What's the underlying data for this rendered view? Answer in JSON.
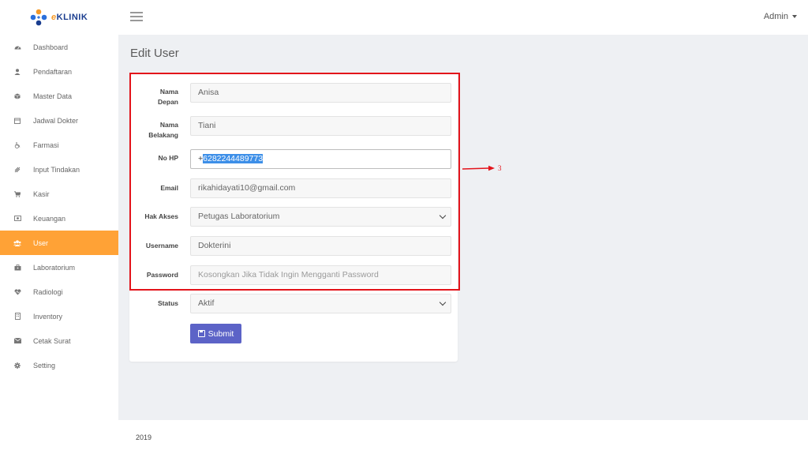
{
  "brand": {
    "logo_text_e": "e",
    "logo_text_rest": "KLINIK"
  },
  "topbar": {
    "user_menu_label": "Admin"
  },
  "sidebar": {
    "items": [
      {
        "label": "Dashboard",
        "icon": "dashboard-icon"
      },
      {
        "label": "Pendaftaran",
        "icon": "user-icon"
      },
      {
        "label": "Master Data",
        "icon": "cube-icon"
      },
      {
        "label": "Jadwal Dokter",
        "icon": "calendar-icon"
      },
      {
        "label": "Farmasi",
        "icon": "wheelchair-icon"
      },
      {
        "label": "Input Tindakan",
        "icon": "medkit-icon"
      },
      {
        "label": "Kasir",
        "icon": "cart-icon"
      },
      {
        "label": "Keuangan",
        "icon": "money-icon"
      },
      {
        "label": "User",
        "icon": "users-icon",
        "active": true
      },
      {
        "label": "Laboratorium",
        "icon": "briefcase-icon"
      },
      {
        "label": "Radiologi",
        "icon": "heartbeat-icon"
      },
      {
        "label": "Inventory",
        "icon": "building-icon"
      },
      {
        "label": "Cetak Surat",
        "icon": "envelope-icon"
      },
      {
        "label": "Setting",
        "icon": "gear-icon"
      }
    ],
    "active_color": "#ffa236"
  },
  "page": {
    "title": "Edit User"
  },
  "form": {
    "nama_depan": {
      "label_1": "Nama",
      "label_2": "Depan",
      "value": "Anisa"
    },
    "nama_belakang": {
      "label_1": "Nama",
      "label_2": "Belakang",
      "value": "Tiani"
    },
    "no_hp": {
      "label": "No HP",
      "value_prefix": "+",
      "value_selected": "6282244489773"
    },
    "email": {
      "label": "Email",
      "value": "rikahidayati10@gmail.com"
    },
    "hak_akses": {
      "label": "Hak Akses",
      "value": "Petugas Laboratorium"
    },
    "username": {
      "label": "Username",
      "value": "Dokterini"
    },
    "password": {
      "label": "Password",
      "placeholder": "Kosongkan Jika Tidak Ingin Mengganti Password"
    },
    "status": {
      "label": "Status",
      "value": "Aktif"
    },
    "submit_label": "Submit"
  },
  "annotation": {
    "number": "3",
    "color": "#e3141b"
  },
  "footer": {
    "text": "2019"
  }
}
